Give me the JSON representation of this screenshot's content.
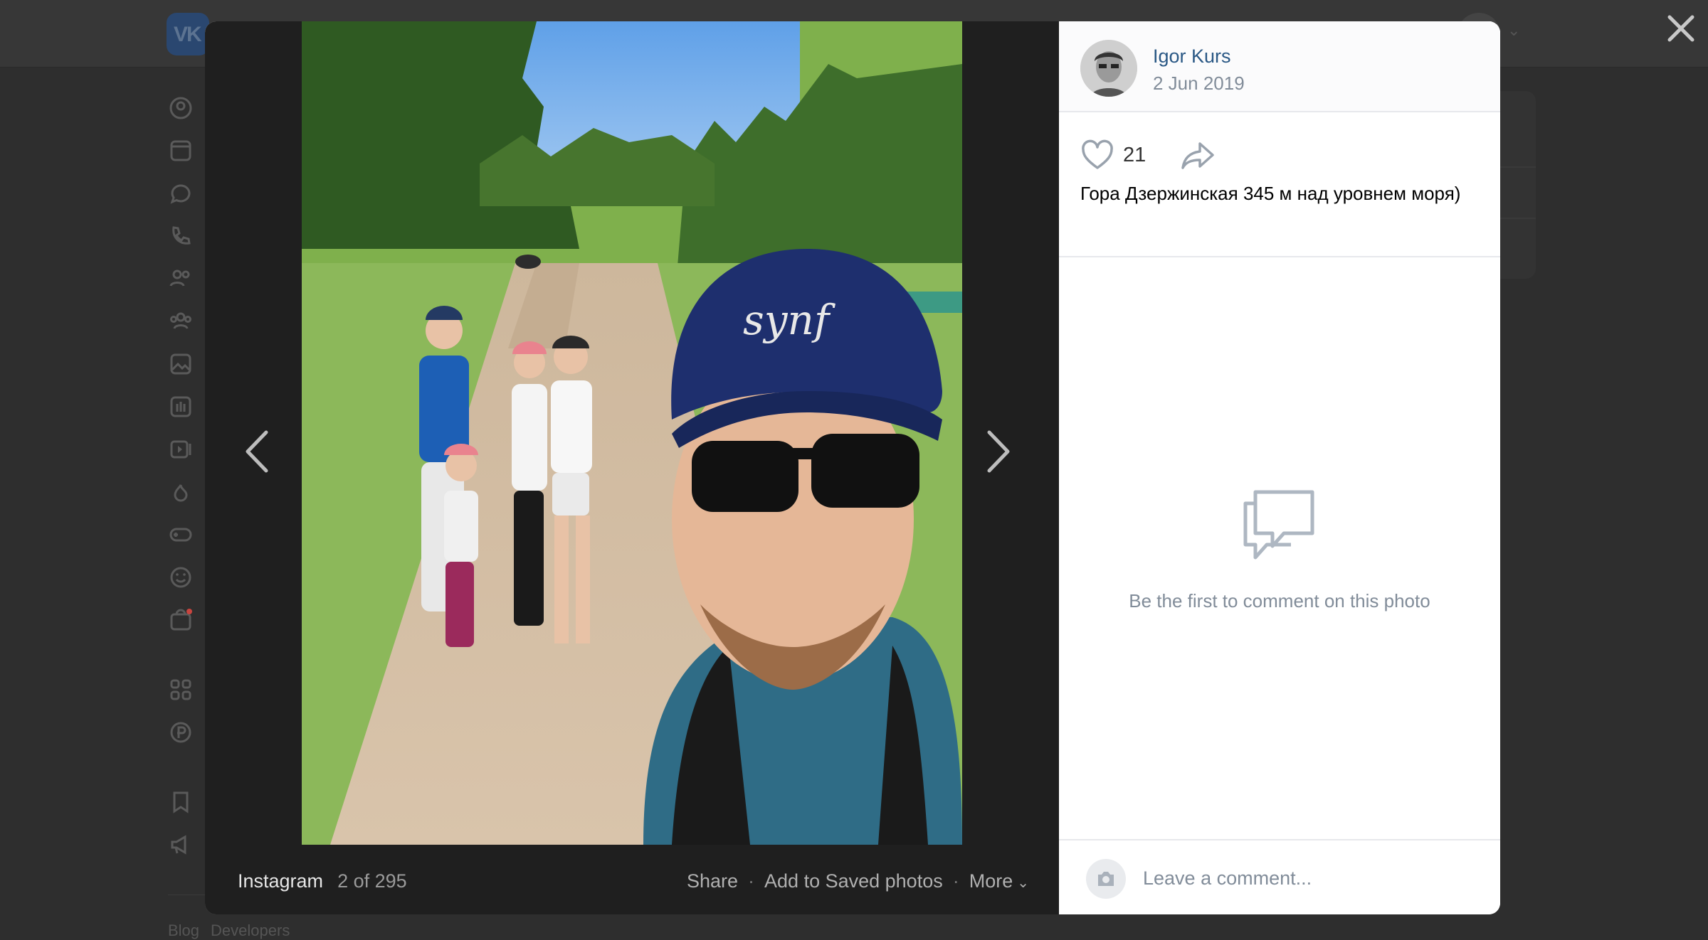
{
  "background": {
    "logo_text": "VK",
    "footer_links": [
      "Blog",
      "Developers"
    ]
  },
  "viewer": {
    "album_source": "Instagram",
    "photo_counter": "2 of 295",
    "actions": {
      "share": "Share",
      "save": "Add to Saved photos",
      "more": "More"
    }
  },
  "author": {
    "name": "Igor Kurs",
    "date": "2 Jun 2019"
  },
  "post": {
    "likes": "21",
    "caption": "Гора Дзержинская 345 м над уровнем моря)"
  },
  "comments": {
    "empty_text": "Be the first to comment on this photo",
    "placeholder": "Leave a comment..."
  },
  "colors": {
    "link": "#2a5885",
    "muted": "#818c99",
    "overlay_bg": "#2e2e2e"
  },
  "icons": {
    "close": "close-icon",
    "prev": "chevron-left-icon",
    "next": "chevron-right-icon",
    "like": "heart-icon",
    "share": "share-arrow-icon",
    "comments_empty": "chat-bubbles-icon",
    "camera": "camera-icon"
  }
}
